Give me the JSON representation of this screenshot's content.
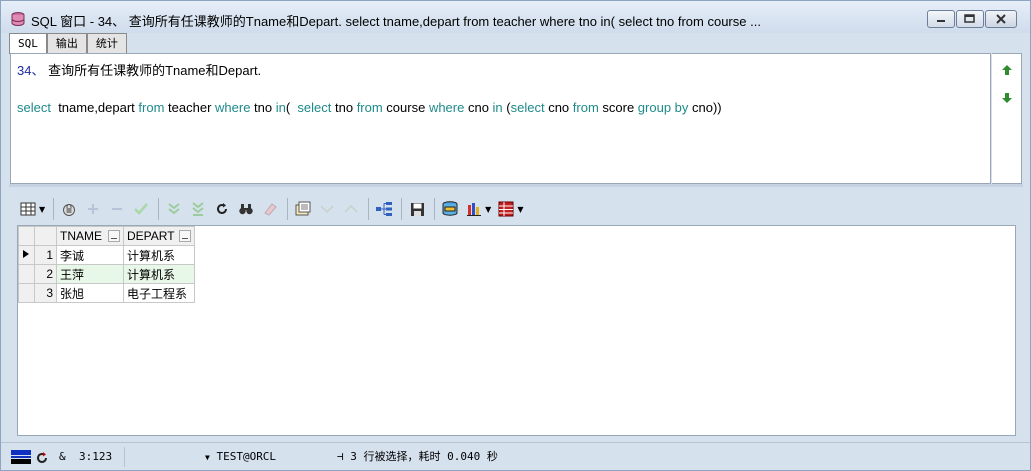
{
  "window": {
    "title": "SQL 窗口 - 34、 查询所有任课教师的Tname和Depart. select tname,depart from teacher where tno in( select tno from course ..."
  },
  "tabs": [
    {
      "label": "SQL",
      "active": true
    },
    {
      "label": "输出",
      "active": false
    },
    {
      "label": "统计",
      "active": false
    }
  ],
  "editor": {
    "line1_num": "34、",
    "line1_text": " 查询所有任课教师的Tname和Depart.",
    "sql": {
      "t1": "select",
      "t2": "  tname,depart ",
      "t3": "from",
      "t4": " teacher ",
      "t5": "where",
      "t6": " tno ",
      "t7": "in",
      "t8": "(  ",
      "t9": "select",
      "t10": " tno ",
      "t11": "from",
      "t12": " course ",
      "t13": "where",
      "t14": " cno ",
      "t15": "in",
      "t16": " (",
      "t17": "select",
      "t18": " cno ",
      "t19": "from",
      "t20": " score ",
      "t21": "group by",
      "t22": " cno))"
    }
  },
  "grid": {
    "columns": [
      "TNAME",
      "DEPART"
    ],
    "rows": [
      {
        "num": "1",
        "tname": "李诚",
        "depart": "计算机系",
        "current": true
      },
      {
        "num": "2",
        "tname": "王萍",
        "depart": "计算机系",
        "current": false
      },
      {
        "num": "3",
        "tname": "张旭",
        "depart": "电子工程系",
        "current": false
      }
    ]
  },
  "statusbar": {
    "position": "3:123",
    "connection": "TEST@ORCL",
    "message": "3 行被选择，耗时 0.040 秒"
  },
  "colors": {
    "keyword": "#1f8a8a",
    "selected_row": "#e8f8e8",
    "frame": "#d6e1ee"
  }
}
